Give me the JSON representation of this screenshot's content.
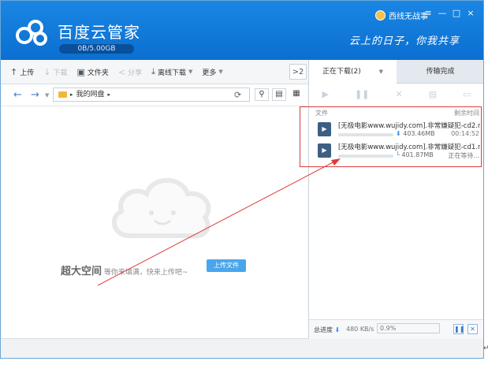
{
  "header": {
    "app_title": "百度云管家",
    "quota": "0B/5.00GB",
    "user_name": "西线无战事",
    "slogan": "云上的日子，你我共享",
    "controls": {
      "menu": "≡",
      "minimize": "—",
      "maximize": "□",
      "close": "×"
    }
  },
  "toolbar": {
    "upload": "上传",
    "download": "下载",
    "new_folder": "文件夹",
    "share": "分享",
    "offline_download": "离线下载",
    "more": "更多",
    "collapse": ">2"
  },
  "nav": {
    "back": "←",
    "forward": "→",
    "path": "我的网盘",
    "path_sep": "▸"
  },
  "empty_state": {
    "big_text": "超大空间",
    "sub_text": "等你来填满，快来上传吧~",
    "upload_button": "上传文件"
  },
  "right_pane": {
    "tab_downloading": "正在下载(2)",
    "tab_completed": "传输完成",
    "col_file": "文件",
    "col_time": "剩余时间",
    "downloads": [
      {
        "name": "[无极电影www.wujidy.com].非常嫌疑犯-cd2.r...",
        "size": "403.46MB",
        "time": "00:14:52",
        "progress": 0.0
      },
      {
        "name": "[无极电影www.wujidy.com].非常嫌疑犯-cd1.r...",
        "size": "401.87MB",
        "time": "正在等待...",
        "progress": 0.0
      }
    ],
    "total_label": "总进度",
    "total_speed": "480 KB/s",
    "total_percent": "0.9%"
  },
  "colors": {
    "header_blue": "#0b6fd0",
    "accent_blue": "#4aa6ec",
    "annotation_red": "#e03a3a"
  }
}
